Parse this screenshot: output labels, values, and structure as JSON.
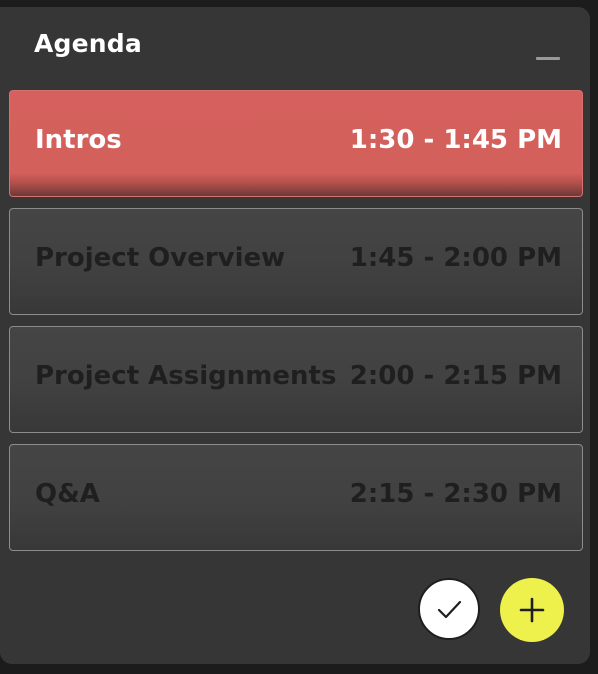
{
  "agenda": {
    "title": "Agenda",
    "items": [
      {
        "name": "Intros",
        "time": "1:30 - 1:45 PM",
        "active": true
      },
      {
        "name": "Project Overview",
        "time": "1:45 - 2:00 PM",
        "active": false
      },
      {
        "name": "Project Assignments",
        "time": "2:00 - 2:15 PM",
        "active": false
      },
      {
        "name": "Q&A",
        "time": "2:15 - 2:30 PM",
        "active": false
      }
    ]
  },
  "actions": {
    "confirm_icon": "checkmark-icon",
    "add_icon": "plus-icon"
  },
  "colors": {
    "active_item": "#d5605d",
    "add_button": "#eef04c",
    "panel": "#363636"
  }
}
